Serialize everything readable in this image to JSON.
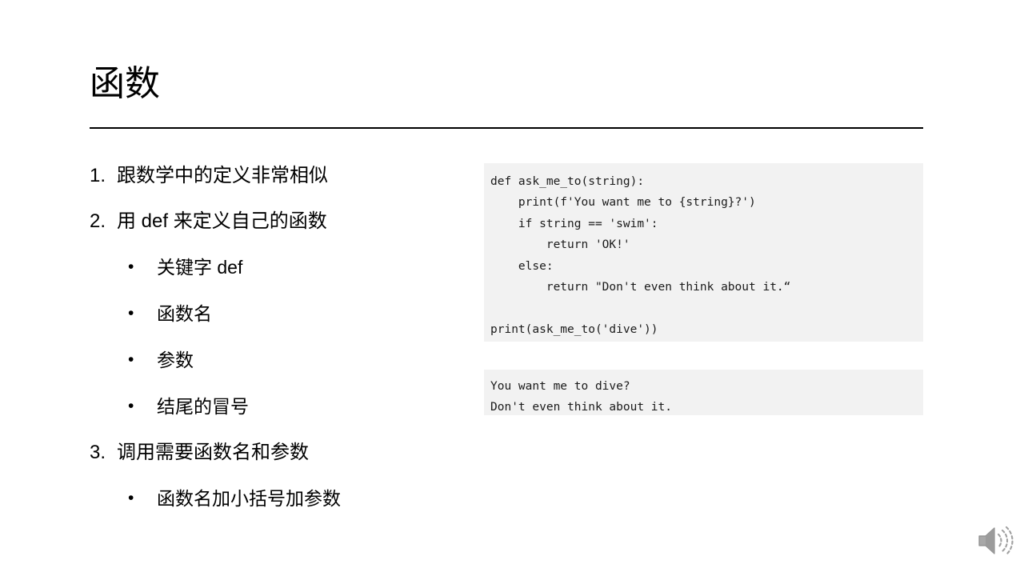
{
  "slide": {
    "title": "函数",
    "background_color": "#ffffff",
    "rule_color": "#000000",
    "code_background_color": "#f2f2f2",
    "text_color": "#000000"
  },
  "outline": [
    {
      "marker": "1.",
      "text": "跟数学中的定义非常相似",
      "level": 1
    },
    {
      "marker": "2.",
      "text": "用 def 来定义自己的函数",
      "level": 1
    },
    {
      "marker": "•",
      "text": "关键字 def",
      "level": 2
    },
    {
      "marker": "•",
      "text": "函数名",
      "level": 2
    },
    {
      "marker": "•",
      "text": "参数",
      "level": 2
    },
    {
      "marker": "•",
      "text": "结尾的冒号",
      "level": 2
    },
    {
      "marker": "3.",
      "text": "调用需要函数名和参数",
      "level": 1
    },
    {
      "marker": "•",
      "text": "函数名加小括号加参数",
      "level": 2
    }
  ],
  "code_block": {
    "language": "python",
    "lines": [
      "def ask_me_to(string):",
      "    print(f'You want me to {string}?')",
      "    if string == 'swim':",
      "        return 'OK!'",
      "    else:",
      "        return \"Don't even think about it.“",
      "",
      "print(ask_me_to('dive'))"
    ],
    "text": "def ask_me_to(string):\n    print(f'You want me to {string}?')\n    if string == 'swim':\n        return 'OK!'\n    else:\n        return \"Don't even think about it.“\n\nprint(ask_me_to('dive'))"
  },
  "output_block": {
    "lines": [
      "You want me to dive?",
      "Don't even think about it."
    ],
    "text": "You want me to dive?\nDon't even think about it."
  },
  "media": {
    "speaker_icon_name": "speaker-audio-icon",
    "speaker_icon_color": "#9a9a9a"
  }
}
